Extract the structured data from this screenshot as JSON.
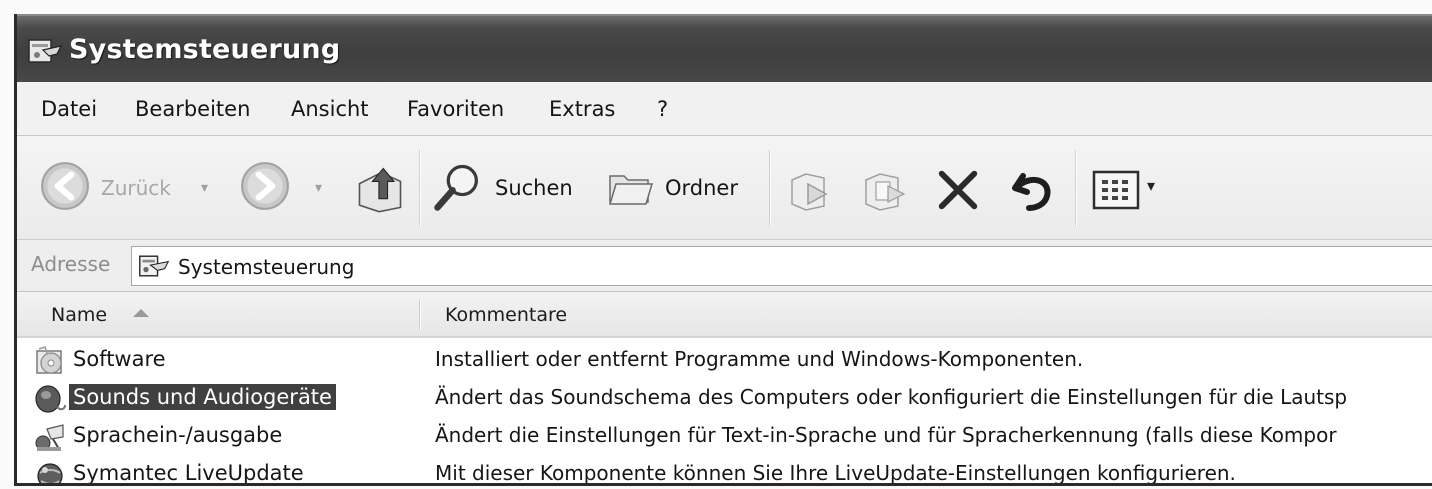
{
  "window": {
    "title": "Systemsteuerung",
    "title_icon": "control-panel-icon"
  },
  "menu": {
    "items": [
      {
        "label": "Datei"
      },
      {
        "label": "Bearbeiten"
      },
      {
        "label": "Ansicht"
      },
      {
        "label": "Favoriten"
      },
      {
        "label": "Extras"
      },
      {
        "label": "?"
      }
    ]
  },
  "toolbar": {
    "back_label": "Zurück",
    "search_label": "Suchen",
    "folders_label": "Ordner",
    "icons": [
      "back-arrow-icon",
      "forward-arrow-icon",
      "up-folder-icon",
      "search-icon",
      "folders-icon",
      "move-to-icon",
      "copy-to-icon",
      "delete-icon",
      "undo-icon",
      "views-icon"
    ]
  },
  "address": {
    "label": "Adresse",
    "value": "Systemsteuerung"
  },
  "list": {
    "columns": [
      {
        "label": "Name"
      },
      {
        "label": "Kommentare"
      }
    ],
    "sort_column": "Name",
    "sort_direction": "ascending",
    "rows": [
      {
        "name": "Software",
        "comment": "Installiert oder entfernt Programme und Windows-Komponenten.",
        "icon": "software-cd-icon",
        "selected": false
      },
      {
        "name": "Sounds und Audiogeräte",
        "comment": "Ändert das Soundschema des Computers oder konfiguriert die Einstellungen für die Lautsp",
        "icon": "speaker-icon",
        "selected": true
      },
      {
        "name": "Sprachein-/ausgabe",
        "comment": "Ändert die Einstellungen für Text-in-Sprache und für Spracherkennung (falls diese Kompor",
        "icon": "speech-icon",
        "selected": false
      },
      {
        "name": "Symantec LiveUpdate",
        "comment": "Mit dieser Komponente können Sie Ihre LiveUpdate-Einstellungen konfigurieren.",
        "icon": "globe-update-icon",
        "selected": false
      }
    ]
  },
  "colors": {
    "titlebar": "#3e3e3e",
    "selection": "#404040"
  }
}
